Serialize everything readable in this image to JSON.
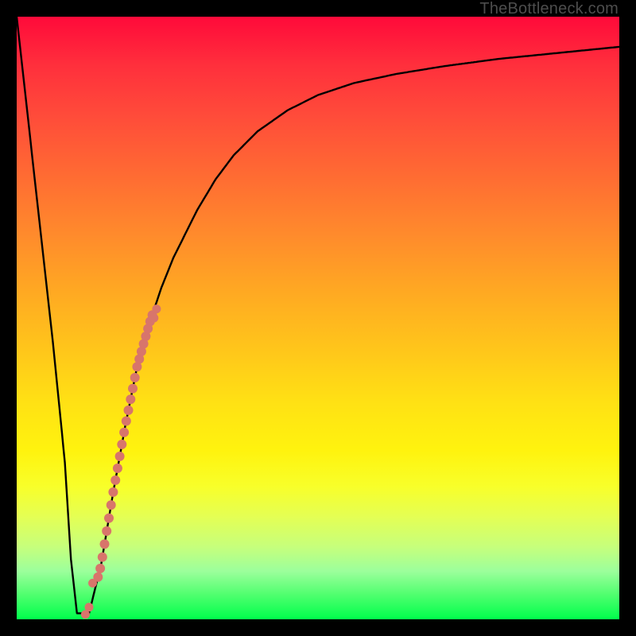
{
  "watermark": "TheBottleneck.com",
  "colors": {
    "frame": "#000000",
    "curve": "#000000",
    "dots": "#d8756b",
    "gradient_top": "#ff0a3a",
    "gradient_bottom": "#00ff4c"
  },
  "chart_data": {
    "type": "line",
    "title": "",
    "xlabel": "",
    "ylabel": "",
    "xlim": [
      0,
      100
    ],
    "ylim": [
      0,
      100
    ],
    "series": [
      {
        "name": "bottleneck-curve",
        "x": [
          0,
          2,
          4,
          6,
          8,
          9,
          10,
          11,
          12,
          14,
          16,
          18,
          20,
          22,
          24,
          26,
          28,
          30,
          33,
          36,
          40,
          45,
          50,
          56,
          63,
          71,
          80,
          90,
          100
        ],
        "y": [
          100,
          82,
          64,
          46,
          26,
          10,
          1,
          1,
          1,
          9,
          21,
          32,
          42,
          49,
          55,
          60,
          64,
          68,
          73,
          77,
          81,
          84.5,
          87,
          89,
          90.5,
          91.8,
          93,
          94,
          95
        ]
      }
    ],
    "markers": [
      {
        "name": "highlighted-points",
        "x_range": [
          13.5,
          22.5
        ],
        "count_dense": 26
      },
      {
        "name": "sparse-dots",
        "points": [
          {
            "x": 12.6,
            "y": 6
          },
          {
            "x": 12.0,
            "y": 2
          },
          {
            "x": 11.4,
            "y": 0.8
          },
          {
            "x": 22.8,
            "y": 50
          },
          {
            "x": 23.2,
            "y": 51.5
          }
        ]
      }
    ]
  }
}
